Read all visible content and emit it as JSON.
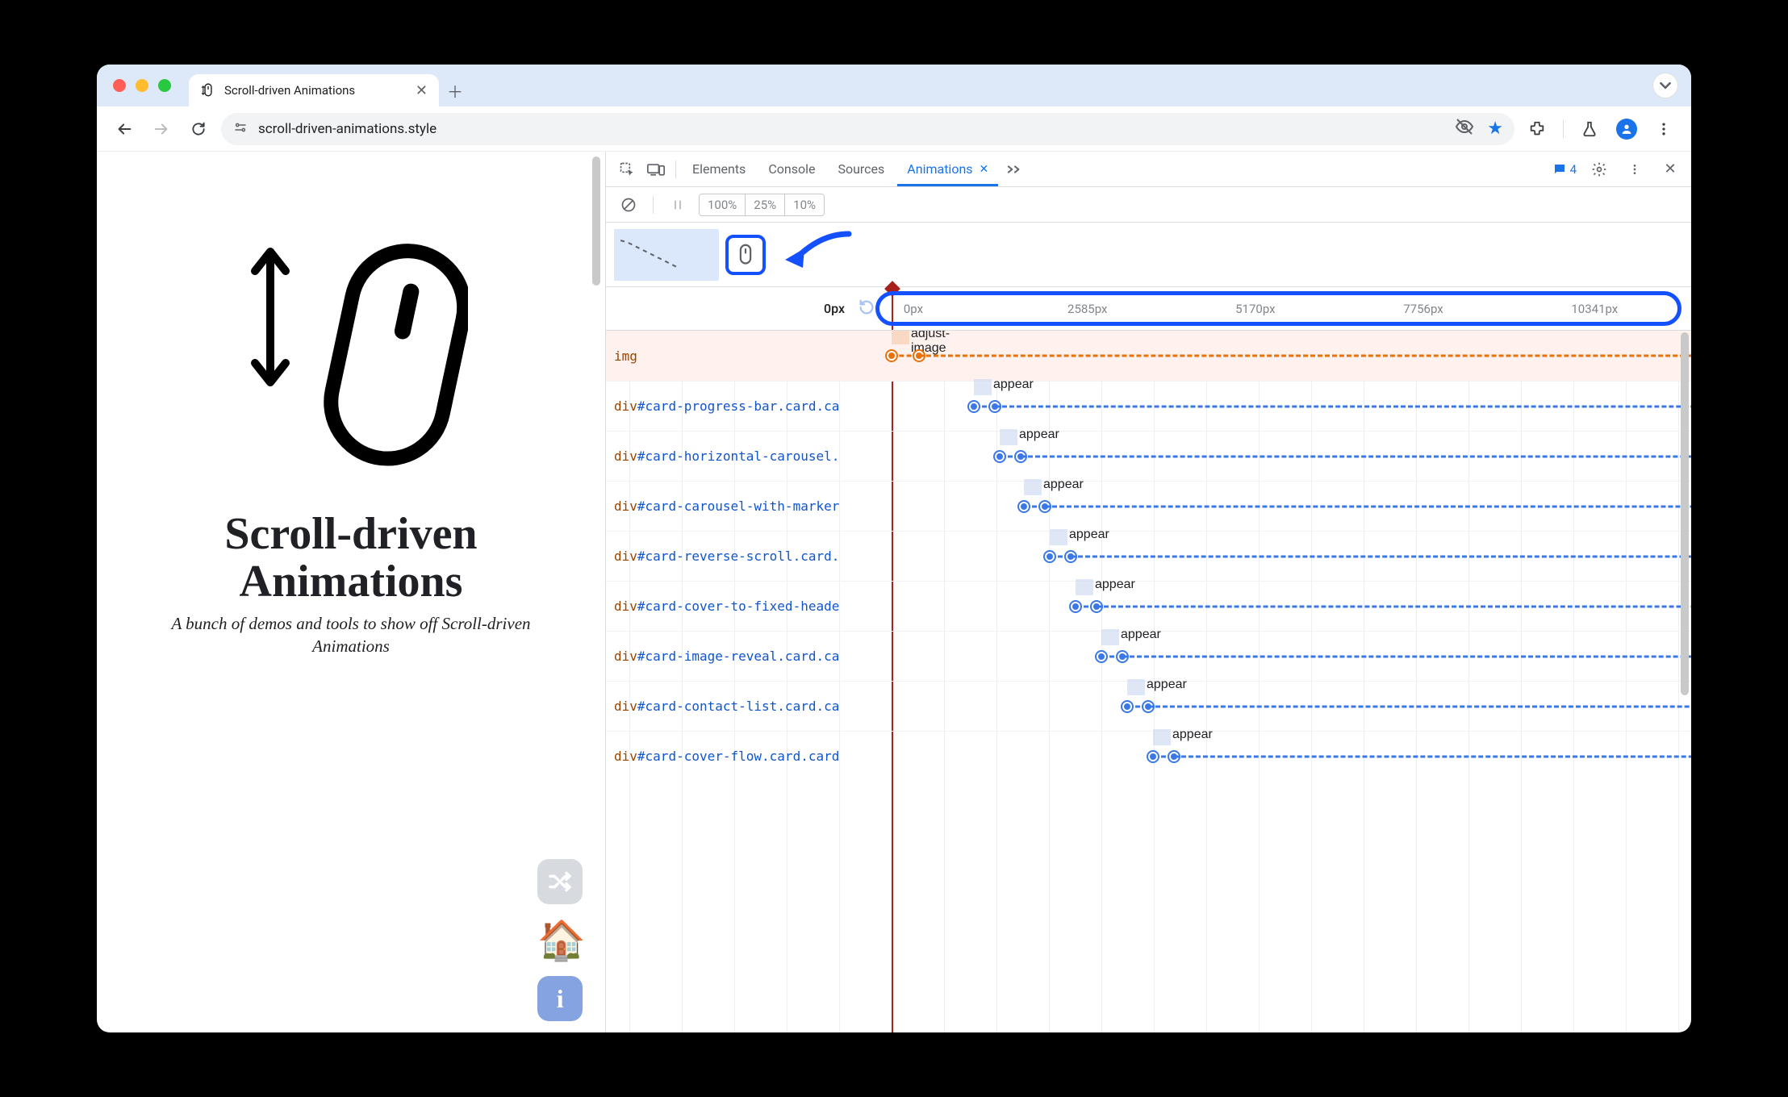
{
  "browser": {
    "tab_title": "Scroll-driven Animations",
    "url": "scroll-driven-animations.style"
  },
  "page": {
    "heading": "Scroll-driven Animations",
    "subtitle": "A bunch of demos and tools to show off Scroll-driven Animations"
  },
  "devtools": {
    "tabs": {
      "elements": "Elements",
      "console": "Console",
      "sources": "Sources",
      "animations": "Animations"
    },
    "issue_count": "4",
    "speeds": {
      "p100": "100%",
      "p25": "25%",
      "p10": "10%"
    },
    "ruler": {
      "current": "0px",
      "ticks": [
        {
          "label": "0px",
          "pct": 1.5
        },
        {
          "label": "2585px",
          "pct": 22
        },
        {
          "label": "5170px",
          "pct": 43
        },
        {
          "label": "7756px",
          "pct": 64
        },
        {
          "label": "10341px",
          "pct": 85
        }
      ]
    },
    "rows": [
      {
        "tag": "img",
        "id": "",
        "cls": "",
        "anim": "adjust-image",
        "offset": 0,
        "len": 34,
        "selected": true
      },
      {
        "tag": "div",
        "id": "#card-progress-bar",
        "cls": ".card.ca",
        "anim": "appear",
        "offset": 102,
        "len": 26,
        "selected": false
      },
      {
        "tag": "div",
        "id": "#card-horizontal-carousel",
        "cls": ".",
        "anim": "appear",
        "offset": 134,
        "len": 26,
        "selected": false
      },
      {
        "tag": "div",
        "id": "#card-carousel-with-marker",
        "cls": "",
        "anim": "appear",
        "offset": 164,
        "len": 26,
        "selected": false
      },
      {
        "tag": "div",
        "id": "#card-reverse-scroll",
        "cls": ".card.",
        "anim": "appear",
        "offset": 196,
        "len": 26,
        "selected": false
      },
      {
        "tag": "div",
        "id": "#card-cover-to-fixed-heade",
        "cls": "",
        "anim": "appear",
        "offset": 228,
        "len": 26,
        "selected": false
      },
      {
        "tag": "div",
        "id": "#card-image-reveal",
        "cls": ".card.ca",
        "anim": "appear",
        "offset": 260,
        "len": 26,
        "selected": false
      },
      {
        "tag": "div",
        "id": "#card-contact-list",
        "cls": ".card.ca",
        "anim": "appear",
        "offset": 292,
        "len": 26,
        "selected": false
      },
      {
        "tag": "div",
        "id": "#card-cover-flow",
        "cls": ".card.card",
        "anim": "appear",
        "offset": 324,
        "len": 26,
        "selected": false
      }
    ]
  }
}
